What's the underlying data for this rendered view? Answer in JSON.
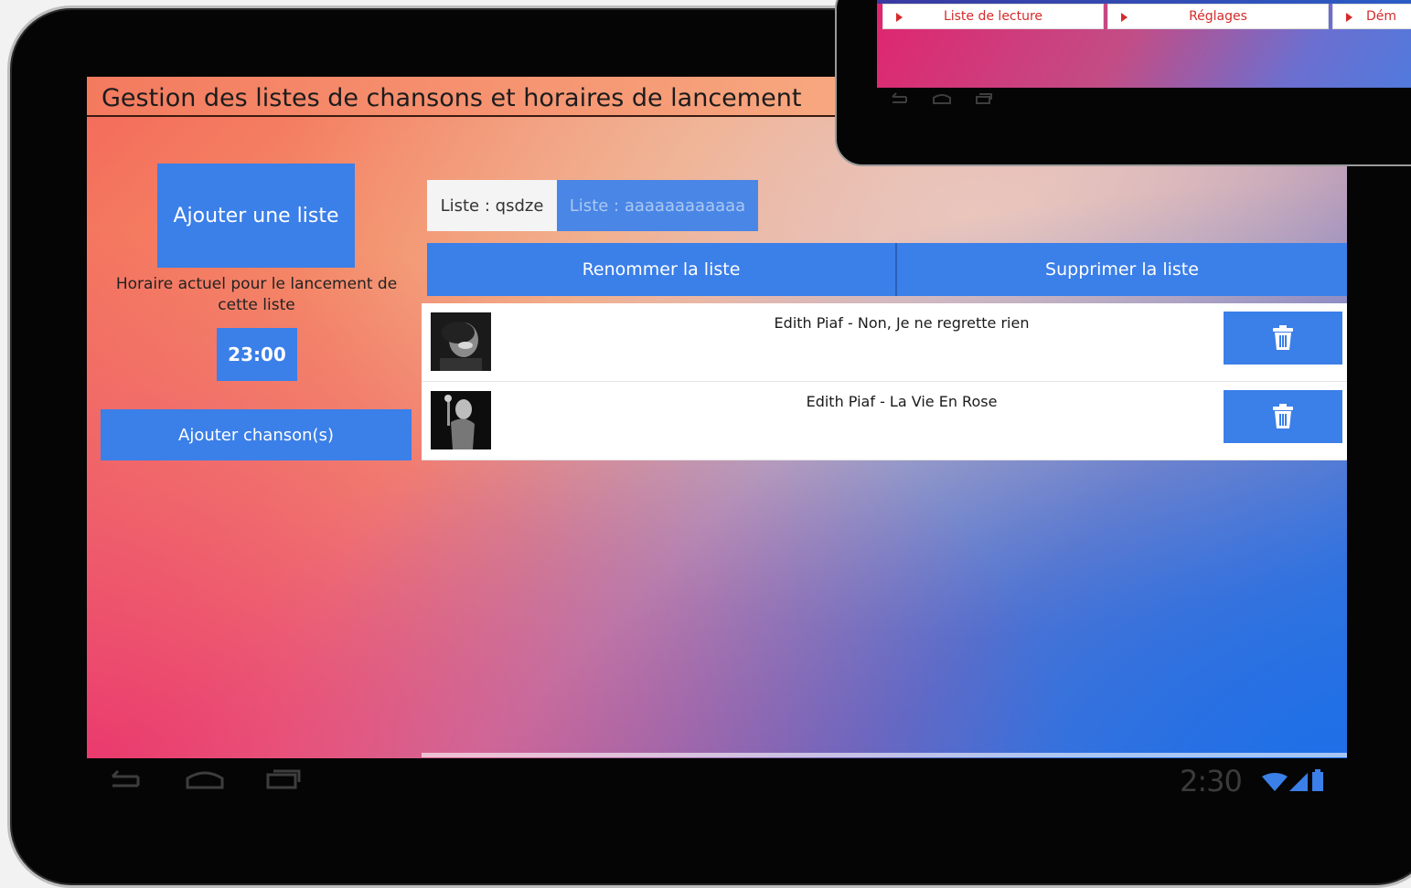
{
  "page_title": "Gestion des listes de chansons et horaires de lancement",
  "sidebar": {
    "add_list_label": "Ajouter une liste",
    "schedule_label": "Horaire actuel pour le lancement de cette liste",
    "schedule_time": "23:00",
    "add_songs_label": "Ajouter chanson(s)"
  },
  "tabs": [
    {
      "label": "Liste : qsdze",
      "active": true
    },
    {
      "label": "Liste : aaaaaaaaaaaa",
      "active": false
    }
  ],
  "actions": {
    "rename_label": "Renommer la liste",
    "delete_label": "Supprimer la liste"
  },
  "songs": [
    {
      "title": "Edith Piaf - Non, Je ne regrette rien"
    },
    {
      "title": "Edith Piaf - La Vie En Rose"
    }
  ],
  "status_bar": {
    "time": "2:30"
  },
  "inset_menu": [
    {
      "label": "Liste de lecture"
    },
    {
      "label": "Réglages"
    },
    {
      "label": "Dém"
    }
  ],
  "icons": [
    "back-icon",
    "home-icon",
    "recent-apps-icon",
    "trash-icon",
    "wifi-icon",
    "signal-icon",
    "battery-icon",
    "play-triangle-icon"
  ],
  "colors": {
    "accent_blue": "#3b7fe8",
    "title_bar": "#f47a5e",
    "inset_menu_text": "#d62a2a"
  }
}
